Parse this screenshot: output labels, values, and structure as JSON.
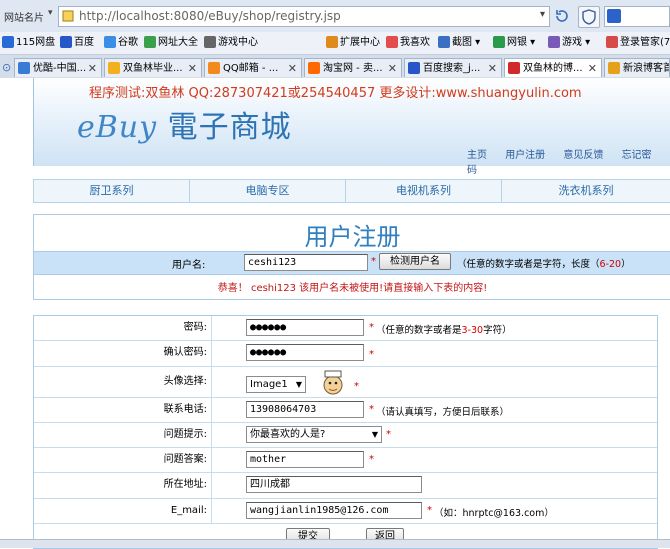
{
  "browser": {
    "site_menu": "网站名片",
    "url": "http://localhost:8080/eBuy/shop/registry.jsp",
    "bookmarks": [
      {
        "label": "115网盘",
        "color": "#2a6ad6"
      },
      {
        "label": "百度",
        "color": "#2756c9"
      },
      {
        "label": "谷歌",
        "color": "#3b8ee6"
      },
      {
        "label": "网址大全",
        "color": "#3aa04a"
      },
      {
        "label": "游戏中心",
        "color": "#666666"
      }
    ],
    "toolbar_right": [
      {
        "label": "扩展中心",
        "color": "#e08a1e"
      },
      {
        "label": "我喜欢",
        "color": "#e24c4c"
      },
      {
        "label": "截图",
        "color": "#3b6fc4"
      },
      {
        "label": "网银",
        "color": "#2a9a4a"
      },
      {
        "label": "游戏",
        "color": "#7a5ab8"
      },
      {
        "label": "登录管家(7)",
        "color": "#d64a4a"
      }
    ],
    "tabs": [
      {
        "label": "优酷-中国...",
        "color": "#3a7bd5"
      },
      {
        "label": "双鱼林毕业...",
        "color": "#f2b01e"
      },
      {
        "label": "QQ邮箱 - ...",
        "color": "#f28a1e"
      },
      {
        "label": "淘宝网 - 卖...",
        "color": "#ff6a00"
      },
      {
        "label": "百度搜索_j...",
        "color": "#2756c9"
      },
      {
        "label": "双鱼林的博...",
        "color": "#d02a2a"
      },
      {
        "label": "新浪博客首",
        "color": "#e4a11b"
      }
    ]
  },
  "banner": {
    "ad_text": "程序测试:双鱼林 QQ:287307421或254540457 更多设计:www.shuangyulin.com",
    "logo_en": "eBuy",
    "logo_cn": "電子商城"
  },
  "top_links": [
    "主页",
    "用户注册",
    "意见反馈",
    "忘记密码"
  ],
  "nav": [
    "厨卫系列",
    "电脑专区",
    "电视机系列",
    "洗衣机系列"
  ],
  "register": {
    "title": "用户注册",
    "username_label": "用户名:",
    "username_value": "ceshi123",
    "check_button": "检测用户名",
    "username_hint_prefix": "（任意的数字或者是字符，长度（",
    "username_hint_range": "6-20",
    "username_hint_suffix": "）",
    "message": "恭喜！ ceshi123 该用户名未被使用!请直接输入下表的内容!"
  },
  "form": {
    "password_label": "密码:",
    "password_value": "●●●●●●",
    "password_hint_prefix": "（任意的数字或者是",
    "password_hint_range": "3-30",
    "password_hint_suffix": "字符）",
    "confirm_label": "确认密码:",
    "confirm_value": "●●●●●●",
    "avatar_label": "头像选择:",
    "avatar_value": "Image1",
    "phone_label": "联系电话:",
    "phone_value": "13908064703",
    "phone_hint": "（请认真填写，方便日后联系）",
    "question_label": "问题提示:",
    "question_value": "你最喜欢的人是?",
    "answer_label": "问题答案:",
    "answer_value": "mother",
    "address_label": "所在地址:",
    "address_value": "四川成都",
    "email_label": "E_mail:",
    "email_value": "wangjianlin1985@126.com",
    "email_hint": "（如：hnrptc@163.com）",
    "submit_label": "提交",
    "back_label": "返回",
    "required_mark": "*"
  },
  "colors": {
    "accent_blue": "#2f7fc1",
    "required_red": "#d10000",
    "row_highlight": "#c9e2f8"
  }
}
